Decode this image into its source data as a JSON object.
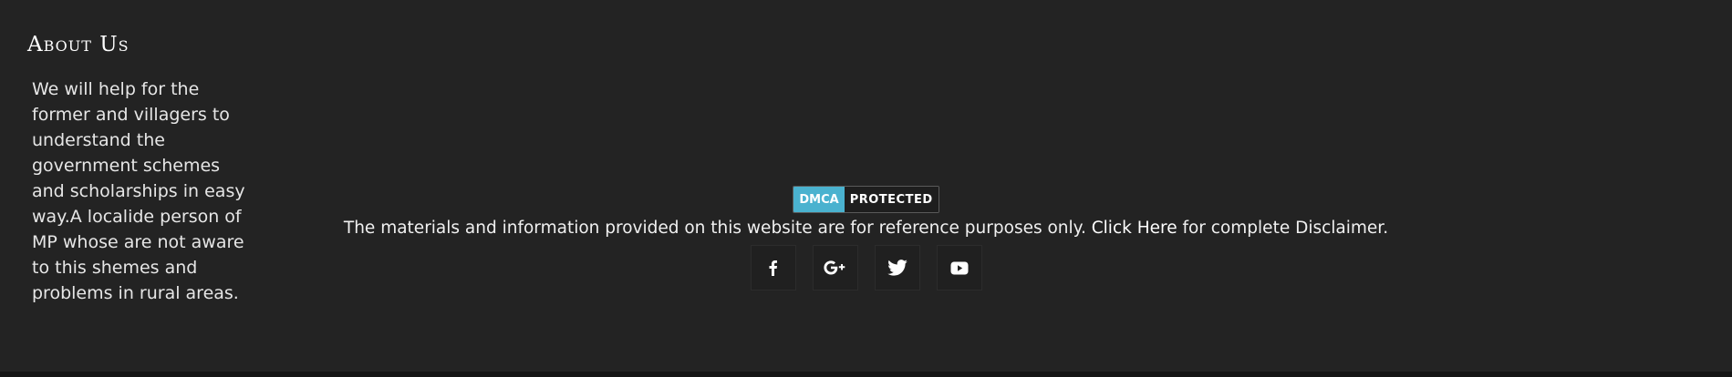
{
  "about": {
    "title": "About Us",
    "text": "We will help for the former and villagers to understand the government schemes and scholarships in easy way.A localide person of MP whose are not aware to this shemes and problems in rural areas."
  },
  "dmca": {
    "left": "DMCA",
    "right": "PROTECTED"
  },
  "disclaimer": {
    "before": "The materials and information provided on this website are for reference purposes only. ",
    "link": "Click Here",
    "after": " for complete Disclaimer."
  },
  "social": [
    {
      "icon": "facebook-icon"
    },
    {
      "icon": "google-plus-icon"
    },
    {
      "icon": "twitter-icon"
    },
    {
      "icon": "youtube-icon"
    }
  ],
  "colors": {
    "background": "#232323",
    "dmca_accent": "#4ab2cf",
    "text": "#e6e6e6"
  }
}
